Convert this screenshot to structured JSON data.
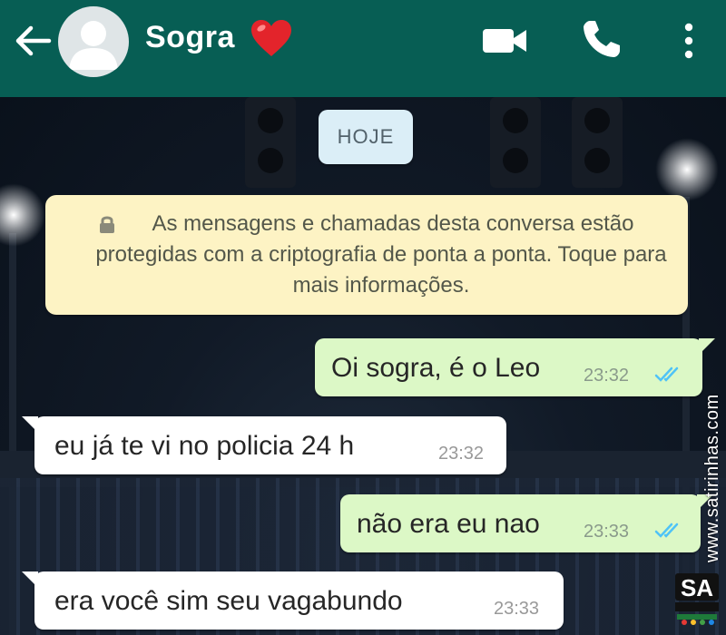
{
  "header": {
    "contact_name": "Sogra",
    "icons": {
      "back": "arrow-left-icon",
      "avatar": "default-avatar-icon",
      "emoji": "red-heart-emoji",
      "video": "video-call-icon",
      "call": "phone-icon",
      "menu": "more-vertical-icon"
    },
    "colors": {
      "bar": "#075e54",
      "text": "#ffffff"
    }
  },
  "chat": {
    "date_chip": "HOJE",
    "encryption_notice": "As mensagens e chamadas desta conversa estão protegidas com a criptografia de ponta a ponta. Toque para mais informações.",
    "messages": [
      {
        "direction": "outgoing",
        "text": "Oi sogra, é o Leo",
        "time": "23:32",
        "status": "read"
      },
      {
        "direction": "incoming",
        "text": "eu já te vi no policia 24 h",
        "time": "23:32"
      },
      {
        "direction": "outgoing",
        "text": "não era eu nao",
        "time": "23:33",
        "status": "read"
      },
      {
        "direction": "incoming",
        "text": "era você sim seu vagabundo",
        "time": "23:33"
      }
    ],
    "colors": {
      "outgoing_bubble": "#dcf8c6",
      "incoming_bubble": "#ffffff",
      "notice_bubble": "#fdf3c4",
      "date_chip": "#dbeef7",
      "read_ticks": "#4fc3f7"
    }
  },
  "watermark": {
    "site": "www.satirinhas.com",
    "logo_text": "SA"
  }
}
